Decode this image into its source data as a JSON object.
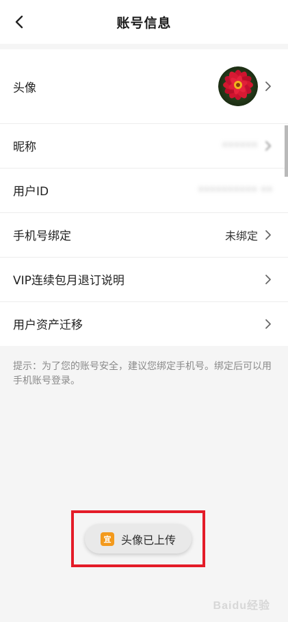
{
  "header": {
    "title": "账号信息",
    "back_icon": "chevron-left-icon"
  },
  "rows": [
    {
      "label": "头像",
      "value": "",
      "type": "avatar"
    },
    {
      "label": "昵称",
      "value": "••••••",
      "type": "blurred"
    },
    {
      "label": "用户ID",
      "value": "•••••••••• ••",
      "type": "blurred"
    },
    {
      "label": "手机号绑定",
      "value": "未绑定",
      "type": "text"
    },
    {
      "label": "VIP连续包月退订说明",
      "value": "",
      "type": "none"
    },
    {
      "label": "用户资产迁移",
      "value": "",
      "type": "none"
    }
  ],
  "tip": "提示：为了您的账号安全，建议您绑定手机号。绑定后可以用手机账号登录。",
  "toast": {
    "text": "头像已上传",
    "icon_char": "宜",
    "icon_color": "#f39a1d"
  },
  "highlight_color": "#e41c28",
  "watermark": "Baidu经验"
}
